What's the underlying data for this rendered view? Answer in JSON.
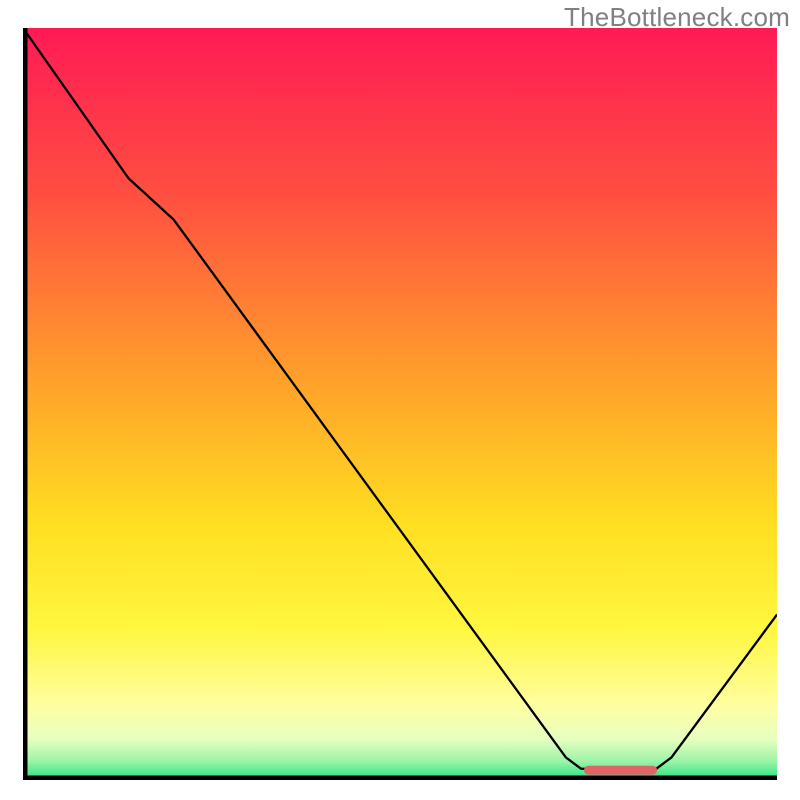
{
  "watermark": "TheBottleneck.com",
  "chart_data": {
    "type": "line",
    "title": "",
    "xlabel": "",
    "ylabel": "",
    "xlim": [
      0,
      100
    ],
    "ylim": [
      0,
      100
    ],
    "gradient_stops": [
      {
        "offset": 0.0,
        "color": "#ff1a55"
      },
      {
        "offset": 0.23,
        "color": "#ff5140"
      },
      {
        "offset": 0.46,
        "color": "#ff9e2b"
      },
      {
        "offset": 0.66,
        "color": "#ffdf21"
      },
      {
        "offset": 0.8,
        "color": "#fff740"
      },
      {
        "offset": 0.9,
        "color": "#fffea0"
      },
      {
        "offset": 0.945,
        "color": "#e8ffc0"
      },
      {
        "offset": 0.975,
        "color": "#9cf4a8"
      },
      {
        "offset": 1.0,
        "color": "#20e27e"
      }
    ],
    "series": [
      {
        "name": "bottleneck-curve",
        "type": "path",
        "color": "#000000",
        "stroke_width": 2.3,
        "points": [
          {
            "x": 0.0,
            "y": 100.0
          },
          {
            "x": 14.0,
            "y": 80.0
          },
          {
            "x": 20.0,
            "y": 74.5
          },
          {
            "x": 72.0,
            "y": 3.0
          },
          {
            "x": 74.0,
            "y": 1.5
          },
          {
            "x": 84.0,
            "y": 1.5
          },
          {
            "x": 86.0,
            "y": 3.0
          },
          {
            "x": 100.0,
            "y": 22.0
          }
        ]
      },
      {
        "name": "optimal-marker",
        "type": "segment",
        "color": "#e06666",
        "stroke_width": 9,
        "linecap": "round",
        "points": [
          {
            "x": 75.0,
            "y": 1.3
          },
          {
            "x": 83.5,
            "y": 1.3
          }
        ]
      }
    ],
    "axes": {
      "left": {
        "color": "#000000",
        "width": 4.5
      },
      "bottom": {
        "color": "#000000",
        "width": 4.5
      }
    }
  }
}
